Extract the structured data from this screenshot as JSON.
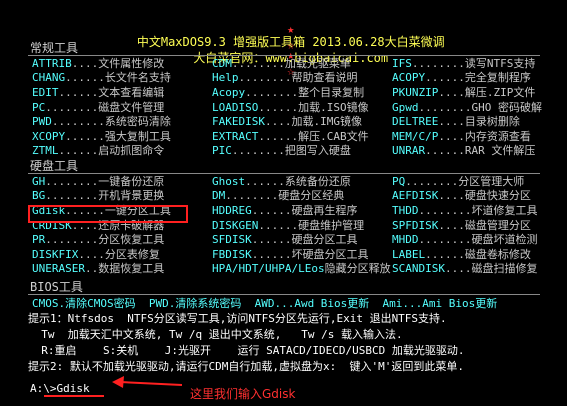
{
  "header": {
    "line1_stars": "★",
    "line1": "中文MaxDOS9.3 增强版工具箱 2013.06.28大白菜微调",
    "line2": "大白菜官网：www.bigbaicai.com",
    "star2": "☆"
  },
  "sections": {
    "common": "常规工具",
    "disk": "硬盘工具",
    "bios": "BIOS工具"
  },
  "common_rows": [
    [
      [
        "ATTRIB",
        "....文件属性修改"
      ],
      [
        "CDM",
        "........加载光驱菜单"
      ],
      [
        "IFS",
        "........读写NTFS支持"
      ]
    ],
    [
      [
        "CHANG",
        "......长文件名支持"
      ],
      [
        "Help",
        "........帮助查看说明"
      ],
      [
        "ACOPY",
        "......完全复制程序"
      ]
    ],
    [
      [
        "EDIT",
        "......文本查看编辑"
      ],
      [
        "Acopy",
        "........整个目录复制"
      ],
      [
        "PKUNZIP",
        "....解压.ZIP文件"
      ]
    ],
    [
      [
        "PC",
        "........磁盘文件管理"
      ],
      [
        "LOADISO",
        "......加载.ISO镜像"
      ],
      [
        "Gpwd",
        "........GHO 密码破解"
      ]
    ],
    [
      [
        "PWD",
        "........系统密码清除"
      ],
      [
        "FAKEDISK",
        "....加载.IMG镜像"
      ],
      [
        "DELTREE",
        "....目录树删除"
      ]
    ],
    [
      [
        "XCOPY",
        "......强大复制工具"
      ],
      [
        "EXTRACT",
        "......解压.CAB文件"
      ],
      [
        "MEM/C/P",
        "....内存资源查看"
      ]
    ],
    [
      [
        "ZTML",
        "......启动抓图命令"
      ],
      [
        "PIC",
        "........把图写入硬盘"
      ],
      [
        "UNRAR",
        "......RAR 文件解压"
      ]
    ]
  ],
  "disk_rows": [
    [
      [
        "GH",
        "........一键备份还原"
      ],
      [
        "Ghost",
        "......系统备份还原"
      ],
      [
        "PQ",
        "........分区管理大师"
      ]
    ],
    [
      [
        "BG",
        "........开机背景更换"
      ],
      [
        "DM",
        "........硬盘分区经典"
      ],
      [
        "AEFDISK",
        "....硬盘快速分区"
      ]
    ],
    [
      [
        "Gdisk",
        "......一键分区工具"
      ],
      [
        "HDDREG",
        "......硬盘再生程序"
      ],
      [
        "THDD",
        "........坏道修复工具"
      ]
    ],
    [
      [
        "CRDISK",
        "....还原卡破解器"
      ],
      [
        "DISKGEN",
        "......硬盘维护管理"
      ],
      [
        "SPFDISK",
        "....磁盘管理分区"
      ]
    ],
    [
      [
        "PR",
        "........分区恢复工具"
      ],
      [
        "SFDISK",
        "......硬盘分区工具"
      ],
      [
        "MHDD",
        "........硬盘坏道检测"
      ]
    ],
    [
      [
        "DISKFIX",
        "....分区表修复"
      ],
      [
        "FBDISK",
        "......坏硬盘分区工具"
      ],
      [
        "LABEL",
        "......磁盘卷标修改"
      ]
    ],
    [
      [
        "UNERASER",
        "..数据恢复工具"
      ],
      [
        "HPA/HDT/UHPA/LEos",
        "隐藏分区释放"
      ],
      [
        "SCANDISK",
        "....磁盘扫描修复"
      ]
    ]
  ],
  "bios_line": "CMOS.清除CMOS密码  PWD.清除系统密码  AWD...Awd Bios更新  Ami...Ami Bios更新",
  "tips": [
    "提示1：Ntfsdos  NTFS分区读写工具,访问NTFS分区先运行,Exit 退出NTFS支持.",
    "  Tw  加载天汇中文系统, Tw /q 退出中文系统,   Tw /s 载入输入法.",
    "  R:重启    S:关机    J:光驱开    运行 SATACD/IDECD/USBCD 加载光驱驱动.",
    "提示2: 默认不加载光驱驱动,请运行CDM自行加载,虚拟盘为x:  键入'M'返回到此菜单."
  ],
  "prompt": "A:\\>Gdisk",
  "annotation": "这里我们输入Gdisk"
}
